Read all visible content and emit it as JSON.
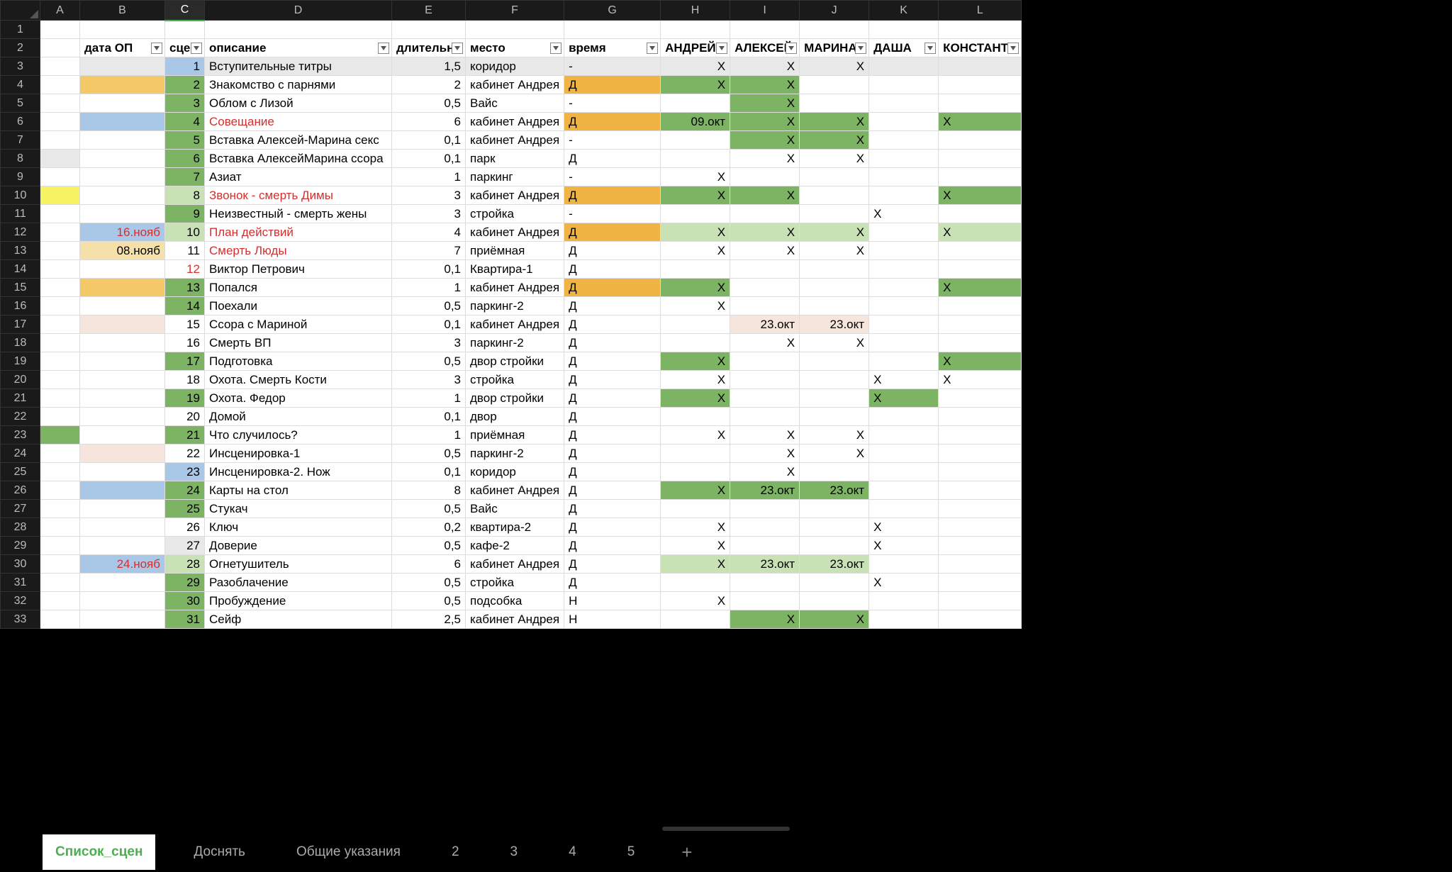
{
  "columns": {
    "letters": [
      "A",
      "B",
      "C",
      "D",
      "E",
      "F",
      "G",
      "H",
      "I",
      "J",
      "K",
      "L"
    ],
    "widths": [
      56,
      120,
      56,
      264,
      104,
      136,
      136,
      98,
      98,
      98,
      98,
      112
    ],
    "selected": "C"
  },
  "headers": {
    "B": "дата ОП",
    "C": "сцен",
    "D": "описание",
    "E": "длительн",
    "F": "место",
    "G": "время",
    "H": "АНДРЕЙ",
    "I": "АЛЕКСЕЙ",
    "J": "МАРИНА",
    "K": "ДАША",
    "L": "КОНСТАНТИ"
  },
  "rows": [
    {
      "n": 3,
      "A": "",
      "B": {
        "v": "",
        "bg": "#e8e8e8"
      },
      "C": {
        "v": "1",
        "bg": "#a9c8e8"
      },
      "D": {
        "v": "Вступительные титры",
        "bg": "#e8e8e8"
      },
      "E": {
        "v": "1,5",
        "bg": "#e8e8e8"
      },
      "F": {
        "v": "коридор",
        "bg": "#e8e8e8"
      },
      "G": {
        "v": "-",
        "bg": "#e8e8e8"
      },
      "H": {
        "v": "X",
        "bg": "#e8e8e8"
      },
      "I": {
        "v": "X",
        "bg": "#e8e8e8"
      },
      "J": {
        "v": "X",
        "bg": "#e8e8e8"
      },
      "K": {
        "v": "",
        "bg": "#e8e8e8"
      },
      "L": {
        "v": "",
        "bg": "#e8e8e8"
      }
    },
    {
      "n": 4,
      "A": "",
      "B": {
        "v": "",
        "bg": "#f4c867"
      },
      "C": {
        "v": "2",
        "bg": "#7cb463"
      },
      "D": "Знакомство с парнями",
      "E": "2",
      "F": "кабинет Андрея",
      "G": {
        "v": "Д",
        "bg": "#f0b445"
      },
      "H": {
        "v": "X",
        "bg": "#7cb463"
      },
      "I": {
        "v": "X",
        "bg": "#7cb463"
      },
      "J": "",
      "K": "",
      "L": ""
    },
    {
      "n": 5,
      "A": "",
      "B": "",
      "C": {
        "v": "3",
        "bg": "#7cb463"
      },
      "D": "Облом с Лизой",
      "E": "0,5",
      "F": "Вайс",
      "G": "-",
      "H": "",
      "I": {
        "v": "X",
        "bg": "#7cb463"
      },
      "J": "",
      "K": "",
      "L": ""
    },
    {
      "n": 6,
      "A": "",
      "B": {
        "v": "",
        "bg": "#a9c8e8"
      },
      "C": {
        "v": "4",
        "bg": "#7cb463"
      },
      "D": {
        "v": "Совещание",
        "cls": "red"
      },
      "E": "6",
      "F": "кабинет Андрея",
      "G": {
        "v": "Д",
        "bg": "#f0b445"
      },
      "H": {
        "v": "09.окт",
        "bg": "#7cb463"
      },
      "I": {
        "v": "X",
        "bg": "#7cb463"
      },
      "J": {
        "v": "X",
        "bg": "#7cb463"
      },
      "K": "",
      "L": {
        "v": "X",
        "bg": "#7cb463"
      }
    },
    {
      "n": 7,
      "A": "",
      "B": "",
      "C": {
        "v": "5",
        "bg": "#7cb463"
      },
      "D": "Вставка Алексей-Марина секс",
      "E": "0,1",
      "F": "кабинет Андрея",
      "G": "-",
      "H": "",
      "I": {
        "v": "X",
        "bg": "#7cb463"
      },
      "J": {
        "v": "X",
        "bg": "#7cb463"
      },
      "K": "",
      "L": ""
    },
    {
      "n": 8,
      "A": {
        "v": "",
        "bg": "#e8e8e8"
      },
      "B": "",
      "C": {
        "v": "6",
        "bg": "#7cb463"
      },
      "D": "Вставка АлексейМарина ссора",
      "E": "0,1",
      "F": "парк",
      "G": "Д",
      "H": "",
      "I": "X",
      "J": "X",
      "K": "",
      "L": ""
    },
    {
      "n": 9,
      "A": "",
      "B": "",
      "C": {
        "v": "7",
        "bg": "#7cb463"
      },
      "D": "Азиат",
      "E": "1",
      "F": "паркинг",
      "G": "-",
      "H": "X",
      "I": "",
      "J": "",
      "K": "",
      "L": ""
    },
    {
      "n": 10,
      "A": {
        "v": "",
        "bg": "#f5f263"
      },
      "B": "",
      "C": {
        "v": "8",
        "bg": "#c8e2b6"
      },
      "D": {
        "v": "Звонок - смерть Димы",
        "cls": "red"
      },
      "E": "3",
      "F": "кабинет Андрея",
      "G": {
        "v": "Д",
        "bg": "#f0b445"
      },
      "H": {
        "v": "X",
        "bg": "#7cb463"
      },
      "I": {
        "v": "X",
        "bg": "#7cb463"
      },
      "J": "",
      "K": "",
      "L": {
        "v": "X",
        "bg": "#7cb463"
      }
    },
    {
      "n": 11,
      "A": "",
      "B": "",
      "C": {
        "v": "9",
        "bg": "#7cb463"
      },
      "D": "Неизвестный - смерть жены",
      "E": "3",
      "F": "стройка",
      "G": "-",
      "H": "",
      "I": "",
      "J": "",
      "K": "X",
      "L": ""
    },
    {
      "n": 12,
      "A": "",
      "B": {
        "v": "16.нояб",
        "bg": "#a9c8e8",
        "cls": "red"
      },
      "C": {
        "v": "10",
        "bg": "#c8e2b6"
      },
      "D": {
        "v": "План действий",
        "cls": "red"
      },
      "E": "4",
      "F": "кабинет Андрея",
      "G": {
        "v": "Д",
        "bg": "#f0b445"
      },
      "H": {
        "v": "X",
        "bg": "#c8e2b6"
      },
      "I": {
        "v": "X",
        "bg": "#c8e2b6"
      },
      "J": {
        "v": "X",
        "bg": "#c8e2b6"
      },
      "K": "",
      "L": {
        "v": "X",
        "bg": "#c8e2b6"
      }
    },
    {
      "n": 13,
      "A": "",
      "B": {
        "v": "08.нояб",
        "bg": "#f4e0a8"
      },
      "C": "11",
      "D": {
        "v": "Смерть Люды",
        "cls": "red"
      },
      "E": "7",
      "F": "приёмная",
      "G": "Д",
      "H": "X",
      "I": "X",
      "J": "X",
      "K": "",
      "L": ""
    },
    {
      "n": 14,
      "A": "",
      "B": "",
      "C": {
        "v": "12",
        "cls": "red"
      },
      "D": "Виктор Петрович",
      "E": "0,1",
      "F": "Квартира-1",
      "G": "Д",
      "H": "",
      "I": "",
      "J": "",
      "K": "",
      "L": ""
    },
    {
      "n": 15,
      "A": "",
      "B": {
        "v": "",
        "bg": "#f4c867"
      },
      "C": {
        "v": "13",
        "bg": "#7cb463"
      },
      "D": "Попался",
      "E": "1",
      "F": "кабинет Андрея",
      "G": {
        "v": "Д",
        "bg": "#f0b445"
      },
      "H": {
        "v": "X",
        "bg": "#7cb463"
      },
      "I": "",
      "J": "",
      "K": "",
      "L": {
        "v": "X",
        "bg": "#7cb463"
      }
    },
    {
      "n": 16,
      "A": "",
      "B": "",
      "C": {
        "v": "14",
        "bg": "#7cb463"
      },
      "D": "Поехали",
      "E": "0,5",
      "F": "паркинг-2",
      "G": "Д",
      "H": "X",
      "I": "",
      "J": "",
      "K": "",
      "L": ""
    },
    {
      "n": 17,
      "A": "",
      "B": {
        "v": "",
        "bg": "#f5e5dc"
      },
      "C": "15",
      "D": "Ссора с Мариной",
      "E": "0,1",
      "F": "кабинет Андрея",
      "G": "Д",
      "H": "",
      "I": {
        "v": "23.окт",
        "bg": "#f5e5dc"
      },
      "J": {
        "v": "23.окт",
        "bg": "#f5e5dc"
      },
      "K": "",
      "L": ""
    },
    {
      "n": 18,
      "A": "",
      "B": "",
      "C": "16",
      "D": "Смерть ВП",
      "E": "3",
      "F": "паркинг-2",
      "G": "Д",
      "H": "",
      "I": "X",
      "J": "X",
      "K": "",
      "L": ""
    },
    {
      "n": 19,
      "A": "",
      "B": "",
      "C": {
        "v": "17",
        "bg": "#7cb463"
      },
      "D": "Подготовка",
      "E": "0,5",
      "F": "двор стройки",
      "G": "Д",
      "H": {
        "v": "X",
        "bg": "#7cb463"
      },
      "I": "",
      "J": "",
      "K": "",
      "L": {
        "v": "X",
        "bg": "#7cb463"
      }
    },
    {
      "n": 20,
      "A": "",
      "B": "",
      "C": "18",
      "D": "Охота. Смерть Кости",
      "E": "3",
      "F": "стройка",
      "G": "Д",
      "H": "X",
      "I": "",
      "J": "",
      "K": "X",
      "L": "X"
    },
    {
      "n": 21,
      "A": "",
      "B": "",
      "C": {
        "v": "19",
        "bg": "#7cb463"
      },
      "D": "Охота. Федор",
      "E": "1",
      "F": "двор стройки",
      "G": "Д",
      "H": {
        "v": "X",
        "bg": "#7cb463"
      },
      "I": "",
      "J": "",
      "K": {
        "v": "X",
        "bg": "#7cb463"
      },
      "L": ""
    },
    {
      "n": 22,
      "A": "",
      "B": "",
      "C": "20",
      "D": "Домой",
      "E": "0,1",
      "F": "двор",
      "G": "Д",
      "H": "",
      "I": "",
      "J": "",
      "K": "",
      "L": ""
    },
    {
      "n": 23,
      "A": {
        "v": "",
        "bg": "#7cb463"
      },
      "B": "",
      "C": {
        "v": "21",
        "bg": "#7cb463"
      },
      "D": "Что случилось?",
      "E": "1",
      "F": "приёмная",
      "G": "Д",
      "H": "X",
      "I": "X",
      "J": "X",
      "K": "",
      "L": ""
    },
    {
      "n": 24,
      "A": "",
      "B": {
        "v": "",
        "bg": "#f5e5dc"
      },
      "C": "22",
      "D": "Инсценировка-1",
      "E": "0,5",
      "F": "паркинг-2",
      "G": "Д",
      "H": "",
      "I": "X",
      "J": "X",
      "K": "",
      "L": ""
    },
    {
      "n": 25,
      "A": "",
      "B": "",
      "C": {
        "v": "23",
        "bg": "#a9c8e8"
      },
      "D": "Инсценировка-2. Нож",
      "E": "0,1",
      "F": "коридор",
      "G": "Д",
      "H": "",
      "I": "X",
      "J": "",
      "K": "",
      "L": ""
    },
    {
      "n": 26,
      "A": "",
      "B": {
        "v": "",
        "bg": "#a9c8e8"
      },
      "C": {
        "v": "24",
        "bg": "#7cb463"
      },
      "D": "Карты на стол",
      "E": "8",
      "F": "кабинет Андрея",
      "G": "Д",
      "H": {
        "v": "X",
        "bg": "#7cb463"
      },
      "I": {
        "v": "23.окт",
        "bg": "#7cb463"
      },
      "J": {
        "v": "23.окт",
        "bg": "#7cb463"
      },
      "K": "",
      "L": ""
    },
    {
      "n": 27,
      "A": "",
      "B": "",
      "C": {
        "v": "25",
        "bg": "#7cb463"
      },
      "D": "Стукач",
      "E": "0,5",
      "F": "Вайс",
      "G": "Д",
      "H": "",
      "I": "",
      "J": "",
      "K": "",
      "L": ""
    },
    {
      "n": 28,
      "A": "",
      "B": "",
      "C": "26",
      "D": "Ключ",
      "E": "0,2",
      "F": "квартира-2",
      "G": "Д",
      "H": "X",
      "I": "",
      "J": "",
      "K": "X",
      "L": ""
    },
    {
      "n": 29,
      "A": "",
      "B": "",
      "C": {
        "v": "27",
        "bg": "#e8e8e8"
      },
      "D": "Доверие",
      "E": "0,5",
      "F": "кафе-2",
      "G": "Д",
      "H": "X",
      "I": "",
      "J": "",
      "K": "X",
      "L": ""
    },
    {
      "n": 30,
      "A": "",
      "B": {
        "v": "24.нояб",
        "bg": "#a9c8e8",
        "cls": "red"
      },
      "C": {
        "v": "28",
        "bg": "#c8e2b6"
      },
      "D": "Огнетушитель",
      "E": "6",
      "F": "кабинет Андрея",
      "G": "Д",
      "H": {
        "v": "X",
        "bg": "#c8e2b6"
      },
      "I": {
        "v": "23.окт",
        "bg": "#c8e2b6"
      },
      "J": {
        "v": "23.окт",
        "bg": "#c8e2b6"
      },
      "K": "",
      "L": ""
    },
    {
      "n": 31,
      "A": "",
      "B": "",
      "C": {
        "v": "29",
        "bg": "#7cb463"
      },
      "D": "Разоблачение",
      "E": "0,5",
      "F": "стройка",
      "G": "Д",
      "H": "",
      "I": "",
      "J": "",
      "K": "X",
      "L": ""
    },
    {
      "n": 32,
      "A": "",
      "B": "",
      "C": {
        "v": "30",
        "bg": "#7cb463"
      },
      "D": "Пробуждение",
      "E": "0,5",
      "F": "подсобка",
      "G": "Н",
      "H": "X",
      "I": "",
      "J": "",
      "K": "",
      "L": ""
    },
    {
      "n": 33,
      "A": "",
      "B": "",
      "C": {
        "v": "31",
        "bg": "#7cb463"
      },
      "D": "Сейф",
      "E": "2,5",
      "F": "кабинет Андрея",
      "G": "Н",
      "H": "",
      "I": {
        "v": "X",
        "bg": "#7cb463"
      },
      "J": {
        "v": "X",
        "bg": "#7cb463"
      },
      "K": "",
      "L": ""
    }
  ],
  "numericCols": [
    "B",
    "C",
    "E",
    "H",
    "I",
    "J"
  ],
  "tabs": {
    "items": [
      "Список_сцен",
      "Доснять",
      "Общие указания",
      "2",
      "3",
      "4",
      "5"
    ],
    "active": 0
  }
}
